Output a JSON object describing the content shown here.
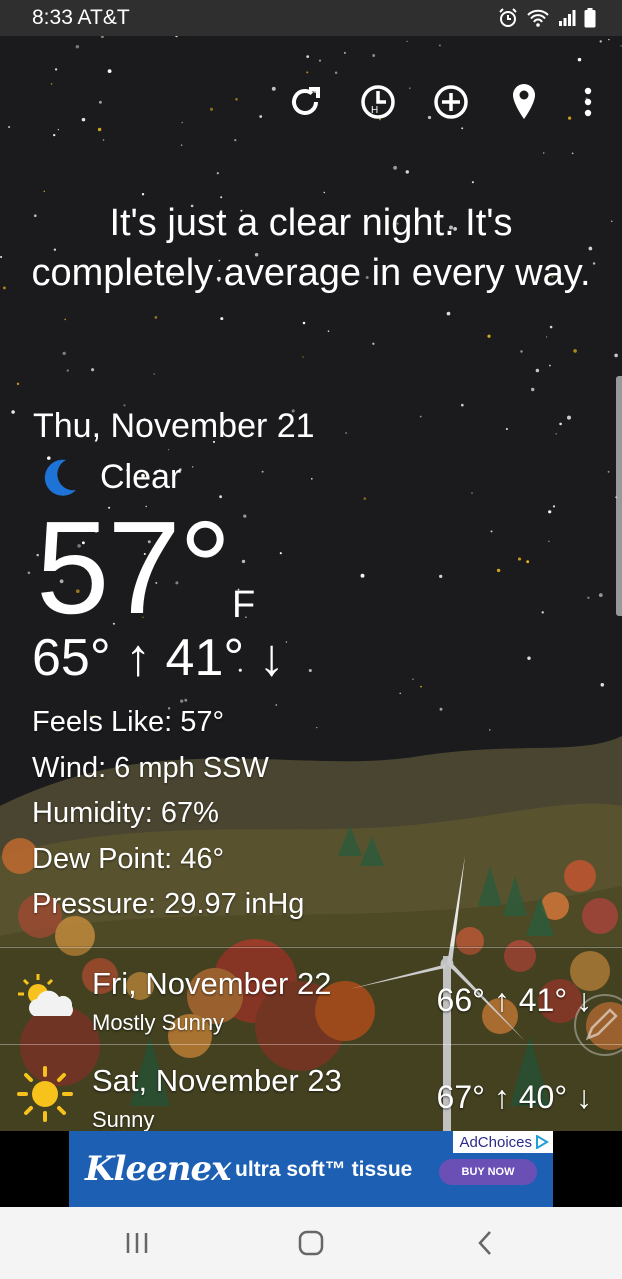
{
  "status_bar": {
    "time": "8:33 AT&T",
    "icons": [
      "alarm-icon",
      "wifi-icon",
      "signal-icon",
      "battery-icon"
    ]
  },
  "toolbar": {
    "buttons": [
      "refresh-icon",
      "history-icon",
      "add-location-icon",
      "location-icon",
      "more-icon"
    ]
  },
  "headline": "It's just a clear night. It's completely average in every way.",
  "current": {
    "date": "Thu, November 21",
    "condition": "Clear",
    "condition_icon": "moon-icon",
    "temperature": "57°",
    "unit": "F",
    "hilo": "65° ↑ 41° ↓",
    "feels_like": "Feels Like: 57°",
    "wind": "Wind: 6 mph SSW",
    "humidity": "Humidity: 67%",
    "dew_point": "Dew Point: 46°",
    "pressure": "Pressure: 29.97 inHg"
  },
  "forecast": [
    {
      "date": "Fri, November 22",
      "desc": "Mostly Sunny",
      "hilo": "66° ↑ 41° ↓",
      "icon": "partly-cloudy-icon"
    },
    {
      "date": "Sat, November 23",
      "desc": "Sunny",
      "hilo": "67° ↑ 40° ↓",
      "icon": "sun-icon"
    }
  ],
  "ad": {
    "brand": "Kleenex",
    "tagline": "ultra soft™ tissue",
    "cta": "BUY NOW",
    "choices": "AdChoices"
  },
  "nav": [
    "recents-icon",
    "home-icon",
    "back-icon"
  ],
  "colors": {
    "sky": "#1b1b1d",
    "sun": "#f7c21b",
    "moon": "#1e73d6",
    "ad_blue": "#1d5fb3"
  }
}
